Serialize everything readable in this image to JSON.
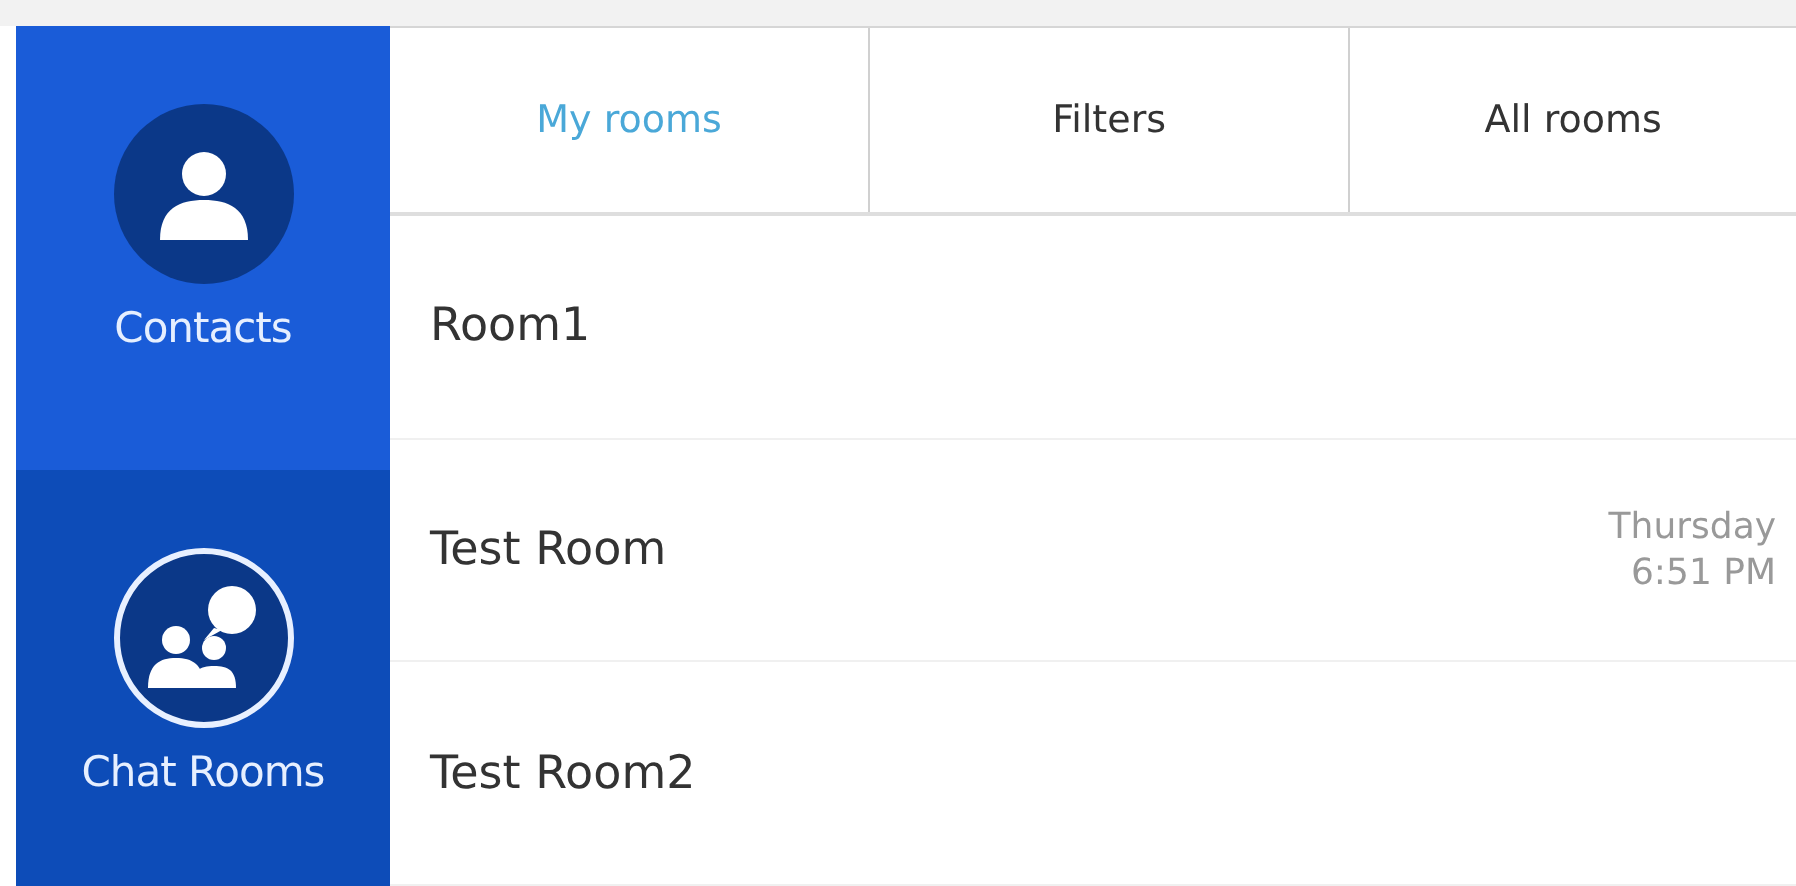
{
  "sidebar": {
    "items": [
      {
        "label": "Contacts",
        "kind": "contacts",
        "selected": false
      },
      {
        "label": "Chat Rooms",
        "kind": "rooms",
        "selected": true
      }
    ]
  },
  "tabs": [
    {
      "label": "My rooms",
      "selected": true
    },
    {
      "label": "Filters",
      "selected": false
    },
    {
      "label": "All rooms",
      "selected": false
    }
  ],
  "rooms": [
    {
      "name": "Room1"
    },
    {
      "name": "Test Room",
      "day": "Thursday",
      "time": "6:51 PM"
    },
    {
      "name": "Test Room2"
    }
  ]
}
